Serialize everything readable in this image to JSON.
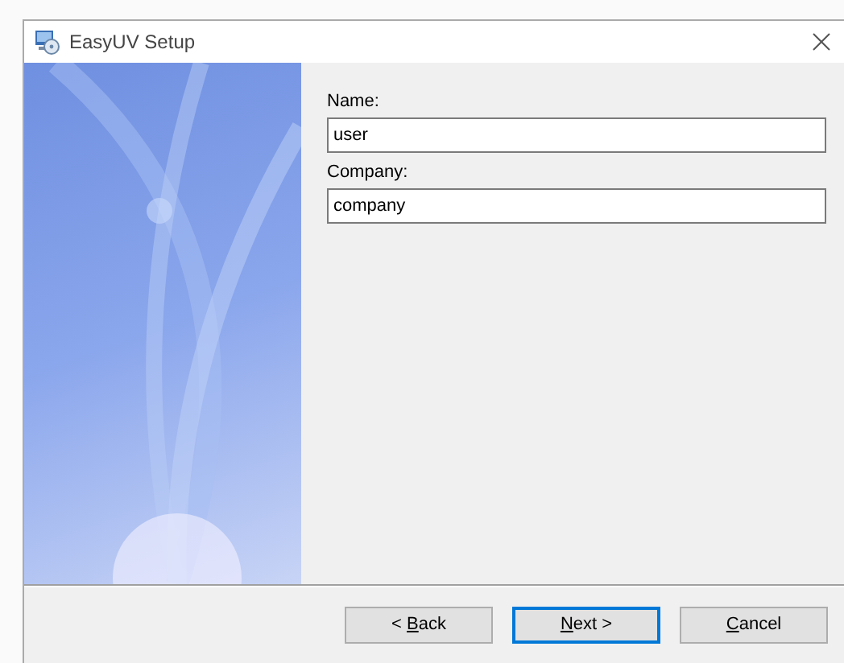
{
  "window": {
    "title": "EasyUV Setup"
  },
  "fields": [
    {
      "label": "Name:",
      "value": "user"
    },
    {
      "label": "Company:",
      "value": "company"
    }
  ],
  "buttons": [
    {
      "prefix": "< ",
      "key": "B",
      "rest": "ack",
      "default": false
    },
    {
      "key": "N",
      "rest": "ext >",
      "default": true
    },
    {
      "key": "C",
      "rest": "ancel",
      "default": false
    }
  ]
}
